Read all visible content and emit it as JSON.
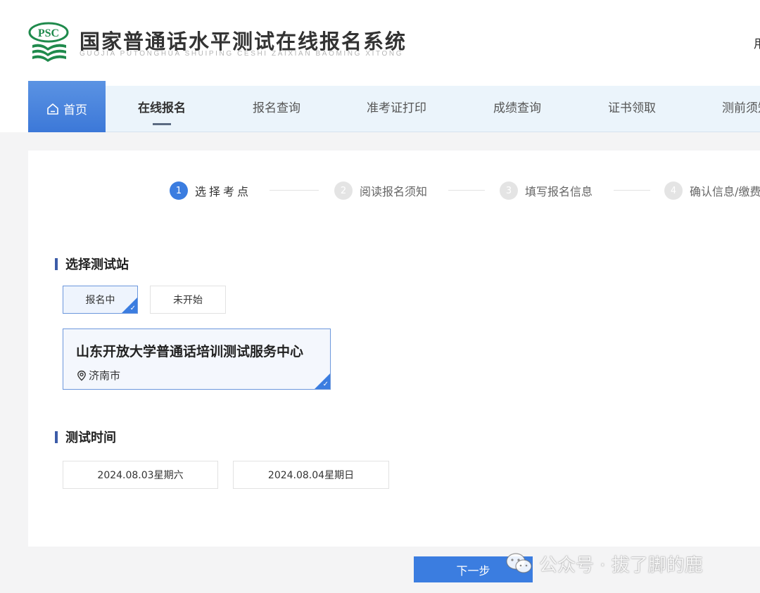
{
  "header": {
    "logo_text": "PSC",
    "title": "国家普通话水平测试在线报名系统",
    "subtitle": "GUOJIA PUTONGHUA SHUIPING CESHI ZAIXIAN BAOMING XITONG",
    "right_partial": "用"
  },
  "nav": {
    "home": "首页",
    "items": [
      {
        "label": "在线报名",
        "active": true
      },
      {
        "label": "报名查询"
      },
      {
        "label": "准考证打印"
      },
      {
        "label": "成绩查询"
      },
      {
        "label": "证书领取"
      },
      {
        "label": "测前须知"
      }
    ]
  },
  "steps": [
    {
      "num": "1",
      "label": "选择考点",
      "active": true
    },
    {
      "num": "2",
      "label": "阅读报名须知"
    },
    {
      "num": "3",
      "label": "填写报名信息"
    },
    {
      "num": "4",
      "label": "确认信息/缴费"
    }
  ],
  "station_section": {
    "title": "选择测试站",
    "filters": [
      {
        "label": "报名中",
        "selected": true
      },
      {
        "label": "未开始"
      }
    ],
    "site": {
      "name": "山东开放大学普通话培训测试服务中心",
      "city": "济南市"
    }
  },
  "time_section": {
    "title": "测试时间",
    "dates": [
      "2024.08.03星期六",
      "2024.08.04星期日"
    ]
  },
  "next_button": "下一步",
  "watermark": "公众号 · 拔了脚的鹿",
  "colors": {
    "accent": "#3b7de0",
    "nav_bg": "#ebf4fb",
    "logo_green": "#1f8a4c"
  },
  "icons": [
    "home-icon",
    "location-pin-icon",
    "check-icon",
    "wechat-icon"
  ]
}
